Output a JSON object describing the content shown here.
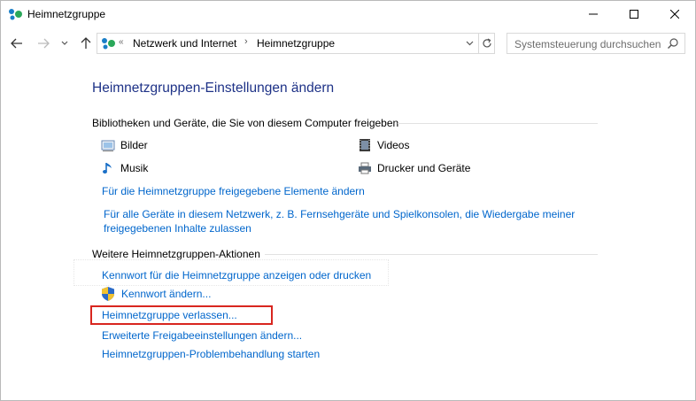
{
  "window": {
    "title": "Heimnetzgruppe",
    "minimize_icon": "minimize-icon",
    "maximize_icon": "maximize-icon",
    "close_icon": "close-icon"
  },
  "nav": {
    "breadcrumb": [
      "Netzwerk und Internet",
      "Heimnetzgruppe"
    ],
    "overflow": "«",
    "search_placeholder": "Systemsteuerung durchsuchen"
  },
  "main": {
    "heading": "Heimnetzgruppen-Einstellungen ändern",
    "libraries": {
      "title": "Bibliotheken und Geräte, die Sie von diesem Computer freigeben",
      "items": [
        {
          "label": "Bilder",
          "icon": "pictures-icon"
        },
        {
          "label": "Videos",
          "icon": "videos-icon"
        },
        {
          "label": "Musik",
          "icon": "music-icon"
        },
        {
          "label": "Drucker und Geräte",
          "icon": "printer-icon"
        }
      ],
      "link_change_items": "Für die Heimnetzgruppe freigegebene Elemente ändern",
      "link_stream": "Für alle Geräte in diesem Netzwerk, z. B. Fernsehgeräte und Spielkonsolen, die Wiedergabe meiner freigegebenen Inhalte zulassen"
    },
    "actions": {
      "title": "Weitere Heimnetzgruppen-Aktionen",
      "links": [
        "Kennwort für die Heimnetzgruppe anzeigen oder drucken",
        "Kennwort ändern...",
        "Heimnetzgruppe verlassen...",
        "Erweiterte Freigabeeinstellungen ändern...",
        "Heimnetzgruppen-Problembehandlung starten"
      ]
    }
  },
  "colors": {
    "heading": "#1e3287",
    "link": "#0066cc",
    "highlight": "#d8261f"
  }
}
